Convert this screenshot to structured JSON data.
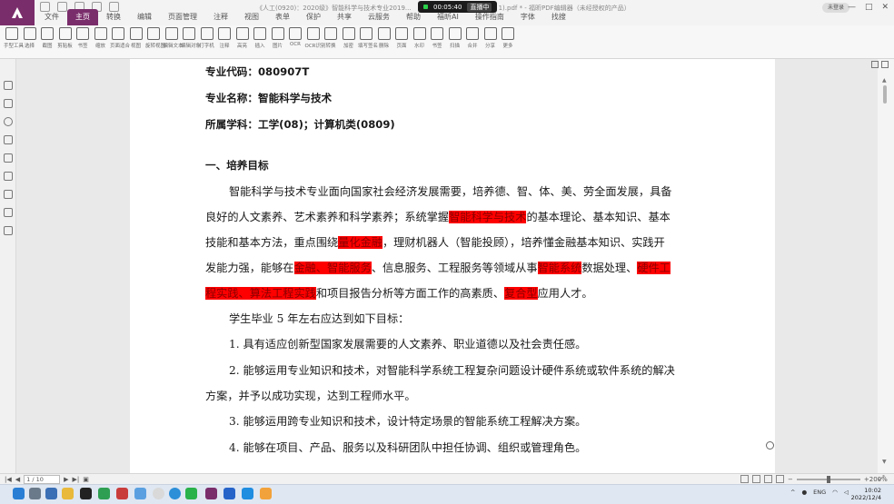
{
  "titlebar": {
    "doc_title": "《人工(0920)：2020级》智能科学与技术专业2019...",
    "doc_title_suffix": "1).pdf * - 福昕PDF编辑器（未经授权的产品）",
    "rec_time": "00:05:40",
    "rec_status": "直播中",
    "login_label": "未登录",
    "window_controls": [
      "—",
      "□",
      "✕"
    ]
  },
  "menu": {
    "items": [
      "文件",
      "主页",
      "转换",
      "编辑",
      "页面管理",
      "注释",
      "视图",
      "表单",
      "保护",
      "共享",
      "云服务",
      "帮助",
      "福昕AI",
      "操作指南",
      "字体",
      "找搜"
    ],
    "active_index": 1
  },
  "ribbon": {
    "tools": [
      "手型工具",
      "选择",
      "截图",
      "剪贴板",
      "书签",
      "缩放",
      "页面适合",
      "视图",
      "旋转视图",
      "编辑文本",
      "编辑对象",
      "打字机",
      "注释",
      "高亮",
      "插入",
      "图片",
      "OCR",
      "OCR识别",
      "转换",
      "加密",
      "填写签名",
      "删除",
      "页面",
      "水印",
      "书签",
      "扫描",
      "合并",
      "分享",
      "更多"
    ]
  },
  "document": {
    "lines": [
      {
        "text": "专业代码：080907T",
        "bold": true
      },
      {
        "text": "专业名称：智能科学与技术",
        "bold": true
      },
      {
        "text": "所属学科：工学(08)；计算机类(0809)",
        "bold": true
      },
      {
        "text": "一、培养目标",
        "bold": true
      },
      {
        "text": "智能科学与技术专业面向国家社会经济发展需要，培养德、智、体、美、劳全面发展，具备"
      },
      {
        "segments": [
          {
            "text": "良好的人文素养、艺术素养和科学素养；系统掌握"
          },
          {
            "text": "智能科学与技术",
            "hl": true
          },
          {
            "text": "的基本理论、基本知识、基本"
          }
        ]
      },
      {
        "segments": [
          {
            "text": "技能和基本方法，重点围绕"
          },
          {
            "text": "量化金融",
            "hl": true
          },
          {
            "text": "，理财机器人（智能投顾），培养懂金融基本知识、实践开"
          }
        ]
      },
      {
        "segments": [
          {
            "text": "发能力强，能够在"
          },
          {
            "text": "金融、智能服务",
            "hl": true
          },
          {
            "text": "、信息服务、工程服务等领域从事"
          },
          {
            "text": "智能系统",
            "hl": true
          },
          {
            "text": "数据处理、"
          },
          {
            "text": "硬件工",
            "hl": true
          }
        ]
      },
      {
        "segments": [
          {
            "text": "程实践、算法工程实践",
            "hl": true
          },
          {
            "text": "和项目报告分析等方面工作的高素质、"
          },
          {
            "text": "复合型",
            "hl": true
          },
          {
            "text": "应用人才。"
          }
        ]
      },
      {
        "text": "学生毕业 5 年左右应达到如下目标："
      },
      {
        "text": "1. 具有适应创新型国家发展需要的人文素养、职业道德以及社会责任感。"
      },
      {
        "text": "2. 能够运用专业知识和技术，对智能科学系统工程复杂问题设计硬件系统或软件系统的解决"
      },
      {
        "text": "方案，并予以成功实现，达到工程师水平。"
      },
      {
        "text": "3. 能够运用跨专业知识和技术，设计特定场景的智能系统工程解决方案。"
      },
      {
        "text": "4. 能够在项目、产品、服务以及科研团队中担任协调、组织或管理角色。"
      }
    ]
  },
  "statusbar": {
    "page_indicator": "1 / 10",
    "zoom": "+200%"
  },
  "taskbar": {
    "lang": "ENG",
    "time": "10:02",
    "date": "2022/12/4"
  },
  "colors": {
    "brand": "#7a2d6b",
    "highlight": "#ff0000"
  }
}
